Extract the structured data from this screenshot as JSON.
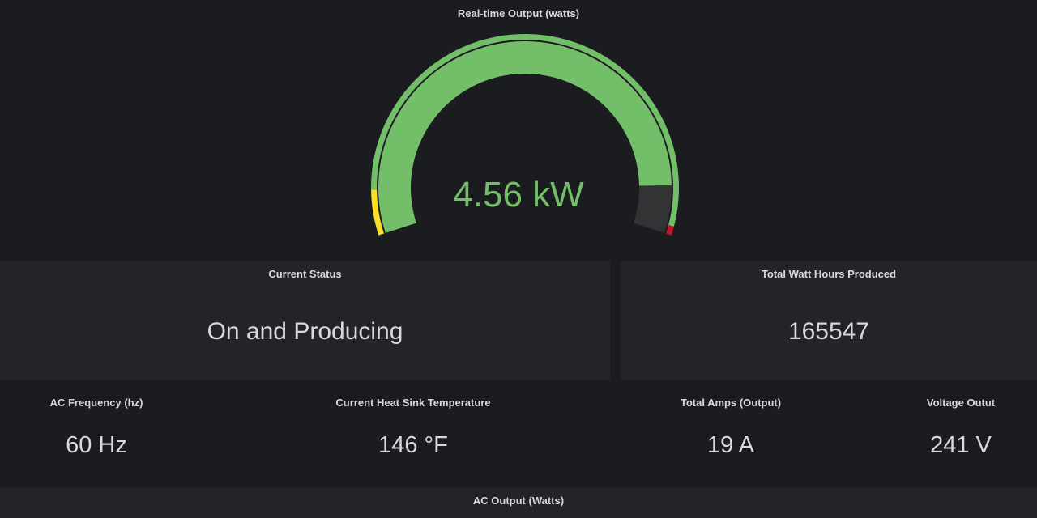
{
  "gauge": {
    "title": "Real-time Output (watts)",
    "value_text": "4.56 kW",
    "value": 4560,
    "min": 0,
    "max": 5000,
    "thresholds": [
      {
        "from": 0,
        "color": "#fade2a"
      },
      {
        "from": 400,
        "color": "#73bf69"
      },
      {
        "from": 4920,
        "color": "#c4162a"
      }
    ],
    "value_color": "#73bf69",
    "track_color": "#333336"
  },
  "status": {
    "title": "Current Status",
    "value": "On and Producing"
  },
  "watt_hours": {
    "title": "Total Watt Hours Produced",
    "value": "165547"
  },
  "stats": [
    {
      "title": "AC Frequency (hz)",
      "value": "60 Hz"
    },
    {
      "title": "Current Heat Sink Temperature",
      "value": "146 °F"
    },
    {
      "title": "Total Amps (Output)",
      "value": "19 A"
    },
    {
      "title": "Voltage Outut",
      "value": "241 V"
    }
  ],
  "ac_output": {
    "title": "AC Output (Watts)"
  }
}
